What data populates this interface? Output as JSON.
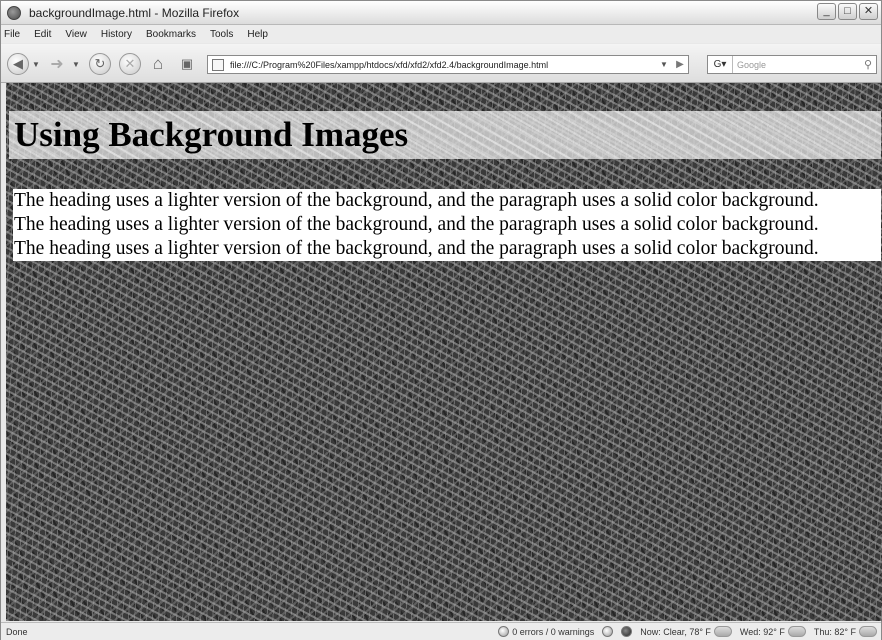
{
  "window": {
    "title": "backgroundImage.html - Mozilla Firefox",
    "controls": {
      "minimize": "_",
      "maximize": "□",
      "close": "✕"
    }
  },
  "menu": [
    "File",
    "Edit",
    "View",
    "History",
    "Bookmarks",
    "Tools",
    "Help"
  ],
  "toolbar": {
    "back_icon": "back-arrow-icon",
    "forward_icon": "forward-arrow-icon",
    "reload_icon": "reload-icon",
    "stop_icon": "stop-icon",
    "home_icon": "home-icon",
    "url": "file:///C:/Program%20Files/xampp/htdocs/xfd/xfd2/xfd2.4/backgroundImage.html",
    "search_engine_label": "G",
    "search_placeholder": "Google"
  },
  "page": {
    "heading": "Using Background Images",
    "paragraph_lines": [
      "The heading uses a lighter version of the background, and the paragraph uses a solid color background.",
      "The heading uses a lighter version of the background, and the paragraph uses a solid color background.",
      "The heading uses a lighter version of the background, and the paragraph uses a solid color background."
    ]
  },
  "status": {
    "text": "Done",
    "errors": "0 errors / 0 warnings",
    "weather_now": "Now: Clear, 78° F",
    "weather_wed": "Wed: 92° F",
    "weather_thu": "Thu: 82° F"
  }
}
